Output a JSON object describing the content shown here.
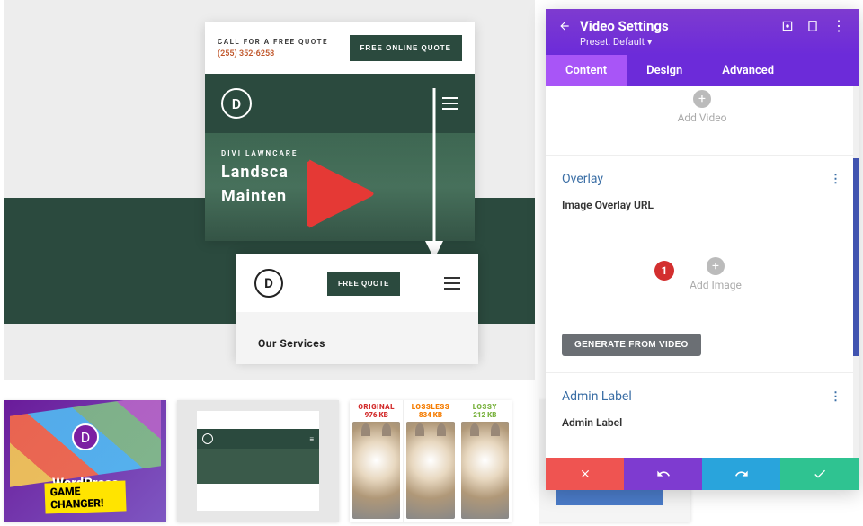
{
  "settings": {
    "title": "Video Settings",
    "preset_label": "Preset: Default",
    "tabs": [
      "Content",
      "Design",
      "Advanced"
    ],
    "active_tab": 0,
    "add_video_label": "Add Video",
    "overlay": {
      "title": "Overlay",
      "field_label": "Image Overlay URL",
      "add_image_label": "Add Image",
      "generate_btn": "GENERATE FROM VIDEO"
    },
    "admin_label": {
      "title": "Admin Label",
      "field_label": "Admin Label"
    }
  },
  "annotation": {
    "marker_1": "1"
  },
  "preview": {
    "call_label": "CALL FOR A FREE QUOTE",
    "phone": "(255) 352-6258",
    "quote_btn": "FREE ONLINE QUOTE",
    "hero_eyebrow": "DIVI LAWNCARE",
    "hero_line1": "Landsca",
    "hero_line2": "Mainten",
    "quote_btn_sm": "FREE QUOTE",
    "services": "Our Services"
  },
  "thumbs": {
    "t1_line1": "WordPress",
    "t1_line2": "GAME CHANGER!",
    "t3_col1_label": "ORIGINAL",
    "t3_col1_size": "976 KB",
    "t3_col2_label": "LOSSLESS",
    "t3_col2_size": "834 KB",
    "t3_col3_label": "LOSSY",
    "t3_col3_size": "212 KB"
  },
  "colors": {
    "orig": "#d32f2f",
    "lossless": "#f57c00",
    "lossy": "#7cb342"
  },
  "icons": {
    "back": "back-arrow-icon",
    "expand": "expand-icon",
    "responsive": "responsive-icon",
    "kebab": "kebab-menu-icon"
  }
}
